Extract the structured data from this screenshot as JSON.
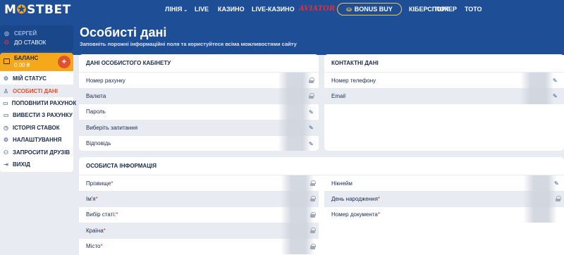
{
  "brand": {
    "logo_pre": "M",
    "logo_star": "✪",
    "logo_post": "STBET"
  },
  "nav": {
    "items": [
      {
        "label": "ЛІНІЯ",
        "has_chevron": true
      },
      {
        "label": "LIVE"
      },
      {
        "label": "КАЗИНО"
      },
      {
        "label": "LIVE-КАЗИНО"
      },
      {
        "label": "Aviator"
      },
      {
        "label": "BONUS BUY"
      },
      {
        "label": "КІБЕРСПОРТ"
      },
      {
        "label": "ПОКЕР"
      },
      {
        "label": "ТОТО"
      }
    ]
  },
  "sidebar": {
    "user_name": "СЕРГЕЙ",
    "to_bets": "ДО СТАВОК",
    "balance_label": "БАЛАНС",
    "balance_amount": "0,00 ₴",
    "menu": [
      {
        "label": "МІЙ СТАТУС",
        "icon": "status-icon"
      },
      {
        "label": "ОСОБИСТІ ДАНІ",
        "icon": "person-icon",
        "active": true
      },
      {
        "label": "ПОПОВНИТИ РАХУНОК",
        "icon": "card-icon"
      },
      {
        "label": "ВИВЕСТИ З РАХУНКУ",
        "icon": "card-icon"
      },
      {
        "label": "ІСТОРІЯ СТАВОК",
        "icon": "clock-icon"
      },
      {
        "label": "НАЛАШТУВАННЯ",
        "icon": "gear-icon"
      },
      {
        "label": "ЗАПРОСИТИ ДРУЗІВ",
        "icon": "friends-icon"
      },
      {
        "label": "ВИХІД",
        "icon": "exit-icon"
      }
    ]
  },
  "main": {
    "title": "Особисті дані",
    "subtitle": "Заповніть порожні інформаційні поля та користуйтеся всіма можливостями сайту",
    "cabinet": {
      "header": "ДАНІ ОСОБИСТОГО КАБІНЕТУ",
      "rows": [
        {
          "label": "Номер рахунку",
          "action": "lock"
        },
        {
          "label": "Валюта",
          "action": "lock"
        },
        {
          "label": "Пароль",
          "action": "edit"
        },
        {
          "label": "Виберіть запитання",
          "action": "edit"
        },
        {
          "label": "Відповідь",
          "action": "edit"
        }
      ]
    },
    "contacts": {
      "header": "КОНТАКТНІ ДАНІ",
      "rows": [
        {
          "label": "Номер телефону",
          "action": "edit"
        },
        {
          "label": "Email",
          "action": "edit"
        }
      ]
    },
    "personal": {
      "header": "ОСОБИСТА ІНФОРМАЦІЯ",
      "left_rows": [
        {
          "label": "Прізвище",
          "required": true,
          "action": "lock"
        },
        {
          "label": "Ім'я",
          "required": true,
          "action": "lock"
        },
        {
          "label": "Вибір статі:",
          "required": true,
          "action": "lock"
        },
        {
          "label": "Країна",
          "required": true,
          "action": "lock"
        },
        {
          "label": "Місто",
          "required": true,
          "action": "lock"
        }
      ],
      "right_rows": [
        {
          "label": "Нікнейм",
          "required": false,
          "action": "edit"
        },
        {
          "label": "День народження",
          "required": true,
          "action": "lock"
        },
        {
          "label": "Номер документа",
          "required": true,
          "action": ""
        }
      ]
    }
  },
  "colors": {
    "nav_bg": "#1e4e96",
    "accent": "#f6a81b",
    "active": "#e0522f",
    "required": "#e0303a"
  }
}
